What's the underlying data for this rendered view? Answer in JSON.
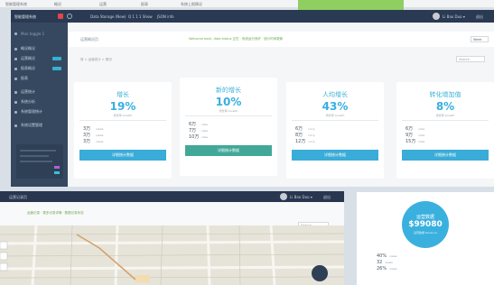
{
  "topstrip": {
    "items": [
      "智能管理系统",
      "概况",
      "运营",
      "报表",
      "系统上报情况"
    ]
  },
  "app": {
    "title": "智能管理系统",
    "toolbar": [
      "Data Storage (New)",
      "Q 1 1 1 Show",
      "JSON info"
    ],
    "user": "Li Bao Duo ▾",
    "exit": "退出"
  },
  "sidebar": {
    "items": [
      {
        "label": "Mon toggle 1"
      },
      {
        "label": "概况概况"
      },
      {
        "label": "运营概况"
      },
      {
        "label": "报表概况"
      },
      {
        "label": "报表"
      },
      {
        "label": "运营统计"
      },
      {
        "label": "系统分析"
      },
      {
        "label": "系统管理统计"
      },
      {
        "label": "系统设置管理"
      }
    ]
  },
  "subheader": {
    "title": "运营概况页",
    "notice": "Welcome back, data status 正在 · 系统运行良好 · 统计时间更新",
    "dropdown": "Week",
    "search": "Search"
  },
  "breadcrumb": "首 > 运营统计 > 概况",
  "cards": [
    {
      "title": "增长",
      "pct": "19%",
      "sub": "增长率 Growth",
      "rows": [
        {
          "n": "3万",
          "u": "views"
        },
        {
          "n": "3万",
          "u": "views"
        },
        {
          "n": "3万",
          "u": "views"
        }
      ],
      "button": "详细统计数据",
      "green": false
    },
    {
      "title": "新的增长",
      "pct": "10%",
      "sub": "增长率 Growth",
      "rows": [
        {
          "n": "6万",
          "u": "view"
        },
        {
          "n": "7万",
          "u": "view"
        },
        {
          "n": "10万",
          "u": "view"
        }
      ],
      "button": "详细统计数据",
      "green": true
    },
    {
      "title": "人均增长",
      "pct": "43%",
      "sub": "增长率 Growth",
      "rows": [
        {
          "n": "6万",
          "u": "curry"
        },
        {
          "n": "8万",
          "u": "curry"
        },
        {
          "n": "12万",
          "u": "curry"
        }
      ],
      "button": "详细统计数据",
      "green": false
    },
    {
      "title": "转化增加值",
      "pct": "8%",
      "sub": "增长率 Growth",
      "rows": [
        {
          "n": "6万",
          "u": "viola"
        },
        {
          "n": "9万",
          "u": "viola"
        },
        {
          "n": "15万",
          "u": "viola"
        }
      ],
      "button": "详细统计数据",
      "green": false
    }
  ],
  "lower": {
    "title": "运营记录页",
    "notice": "运营记录 · 更多记录详情 · 数据记录状态",
    "search": "Search",
    "user": "Li Bao Duo ▾",
    "exit": "退出"
  },
  "donut": {
    "title": "运营数据",
    "value": "$99080",
    "sub": "运营数据 Revenue",
    "rows": [
      {
        "n": "40%",
        "u": "views"
      },
      {
        "n": "32",
        "u": "views"
      },
      {
        "n": "26%",
        "u": "views"
      }
    ]
  }
}
